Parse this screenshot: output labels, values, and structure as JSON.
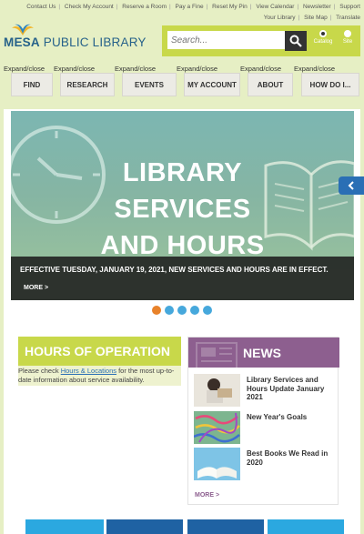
{
  "utility_links": [
    "Contact Us",
    "Check My Account",
    "Reserve a Room",
    "Pay a Fine",
    "Reset My Pin",
    "View Calendar",
    "Newsletter",
    "Support Your Library",
    "Site Map",
    "Translate"
  ],
  "logo": {
    "bold": "MESA",
    "light": "PUBLIC LIBRARY"
  },
  "search": {
    "placeholder": "Search...",
    "option_catalog": "Catalog",
    "option_site": "Site"
  },
  "nav": {
    "expand_label": "Expand/close",
    "items": [
      "FIND",
      "RESEARCH",
      "EVENTS",
      "MY ACCOUNT",
      "ABOUT",
      "HOW DO I..."
    ]
  },
  "hero": {
    "line1": "LIBRARY",
    "line2": "SERVICES",
    "line3": "AND HOURS",
    "caption": "EFFECTIVE TUESDAY, JANUARY 19, 2021, NEW SERVICES AND HOURS ARE IN EFFECT.",
    "more": "MORE >"
  },
  "carousel_active": 1,
  "hours": {
    "title": "HOURS OF OPERATION",
    "text_before": "Please check ",
    "link": "Hours & Locations",
    "text_after": " for the most up-to-date information about service availability."
  },
  "news": {
    "title": "NEWS",
    "items": [
      {
        "title": "Library Services and Hours Update January 2021",
        "icon": "reading-child-photo"
      },
      {
        "title": "New Year's Goals",
        "icon": "confetti-photo"
      },
      {
        "title": "Best Books We Read in 2020",
        "icon": "open-book-photo"
      }
    ],
    "more": "MORE >"
  },
  "colors": {
    "accent_green": "#c8d84a",
    "brand_blue": "#27628a",
    "news_purple": "#8d5f8f",
    "dot_blue": "#46a8dc",
    "dot_orange": "#e8822a"
  }
}
